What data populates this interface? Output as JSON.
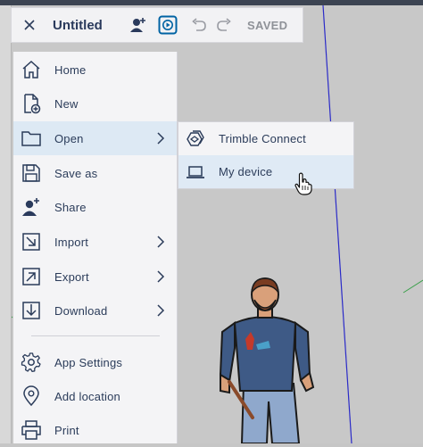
{
  "toolbar": {
    "title": "Untitled",
    "status": "SAVED",
    "icons": [
      "close-icon",
      "add-user-icon",
      "present-icon",
      "undo-icon",
      "redo-icon"
    ]
  },
  "menu": {
    "items": [
      {
        "label": "Home",
        "icon": "home-icon"
      },
      {
        "label": "New",
        "icon": "new-file-icon"
      },
      {
        "label": "Open",
        "icon": "folder-icon",
        "active": true
      },
      {
        "label": "Save as",
        "icon": "save-icon"
      },
      {
        "label": "Share",
        "icon": "share-user-icon"
      },
      {
        "label": "Import",
        "icon": "import-icon"
      },
      {
        "label": "Export",
        "icon": "export-icon"
      },
      {
        "label": "Download",
        "icon": "download-icon"
      },
      {
        "label": "App Settings",
        "icon": "gear-icon"
      },
      {
        "label": "Add location",
        "icon": "location-pin-icon"
      },
      {
        "label": "Print",
        "icon": "printer-icon"
      }
    ]
  },
  "submenu": {
    "items": [
      {
        "label": "Trimble Connect",
        "icon": "trimble-connect-icon"
      },
      {
        "label": "My device",
        "icon": "laptop-icon",
        "hover": true
      }
    ]
  },
  "colors": {
    "accent": "#0063a3",
    "text": "#2b3c5a",
    "active_bg": "#dde9f4",
    "panel_bg": "#f4f4f6",
    "viewport_bg": "#c8c8c8"
  }
}
